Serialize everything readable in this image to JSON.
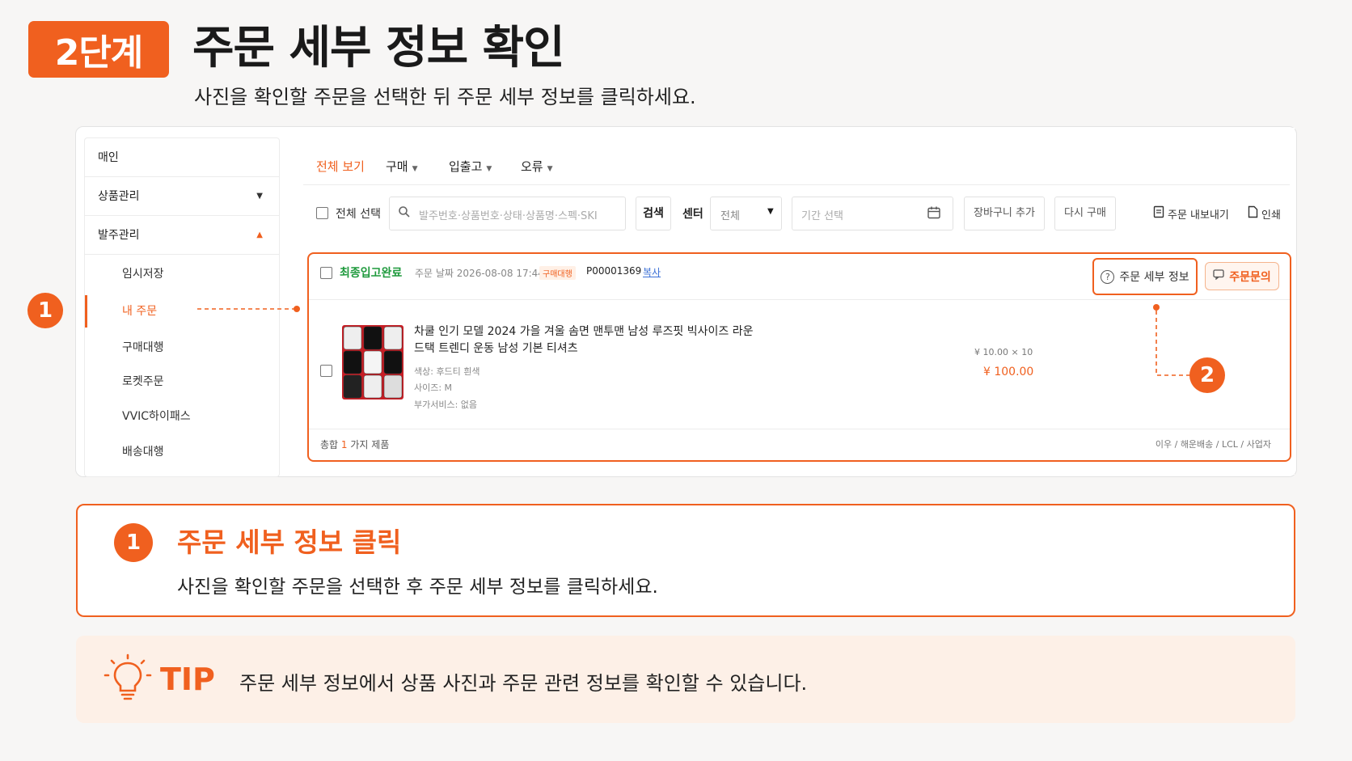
{
  "header": {
    "step_badge": "2단계",
    "title": "주문 세부 정보 확인",
    "subtitle": "사진을 확인할 주문을 선택한 뒤 주문 세부 정보를 클릭하세요."
  },
  "sidebar": {
    "items": [
      {
        "label": "매인"
      },
      {
        "label": "상품관리"
      },
      {
        "label": "발주관리"
      },
      {
        "label": "임시저장"
      },
      {
        "label": "내 주문"
      },
      {
        "label": "구매대행"
      },
      {
        "label": "로켓주문"
      },
      {
        "label": "VVIC하이패스"
      },
      {
        "label": "배송대행"
      }
    ]
  },
  "tabs": [
    {
      "label": "전체 보기"
    },
    {
      "label": "구매"
    },
    {
      "label": "입출고"
    },
    {
      "label": "오류"
    }
  ],
  "toolbar": {
    "select_all": "전체 선택",
    "search_placeholder": "발주번호·상품번호·상태·상품명·스펙·SKI",
    "search_button": "검색",
    "center_label": "센터",
    "center_value": "전체",
    "period_placeholder": "기간 선택",
    "add_cart": "장바구니 추가",
    "rebuy": "다시 구매",
    "export": "주문 내보내기",
    "print": "인쇄"
  },
  "order": {
    "status": "최종입고완료",
    "date_label": "주문 날짜 2026-08-08 17:44",
    "tag": "구매대행",
    "order_no": "P00001369",
    "copy": "복사",
    "detail_button": "주문 세부 정보",
    "inquiry_button": "주문문의",
    "product_name": "차쿨 인기 모델 2024 가을 겨울 솜면 맨투맨 남성 루즈핏 빅사이즈 라운 드택 트렌디 운동 남성 기본 티셔츠",
    "option_color": "색상: 후드티 흰색",
    "option_size": "사이즈: M",
    "option_service": "부가서비스: 없음",
    "unit_price": "¥ 10.00 × 10",
    "total_price": "¥ 100.00",
    "footer_prefix": "총합",
    "footer_count": "1",
    "footer_suffix": "가지 제품",
    "footer_right": "이우 / 해운배송 / LCL / 사업자"
  },
  "markers": {
    "one": "1",
    "two": "2"
  },
  "card": {
    "number": "1",
    "title": "주문 세부 정보 클릭",
    "desc": "사진을 확인할 주문을 선택한 후 주문 세부 정보를 클릭하세요."
  },
  "tip": {
    "label": "TIP",
    "text": "주문 세부 정보에서 상품 사진과 주문 관련 정보를 확인할 수 있습니다."
  },
  "colors": {
    "accent": "#f0601f",
    "status_green": "#1f9a3d",
    "tip_bg": "#fdf0e7"
  }
}
